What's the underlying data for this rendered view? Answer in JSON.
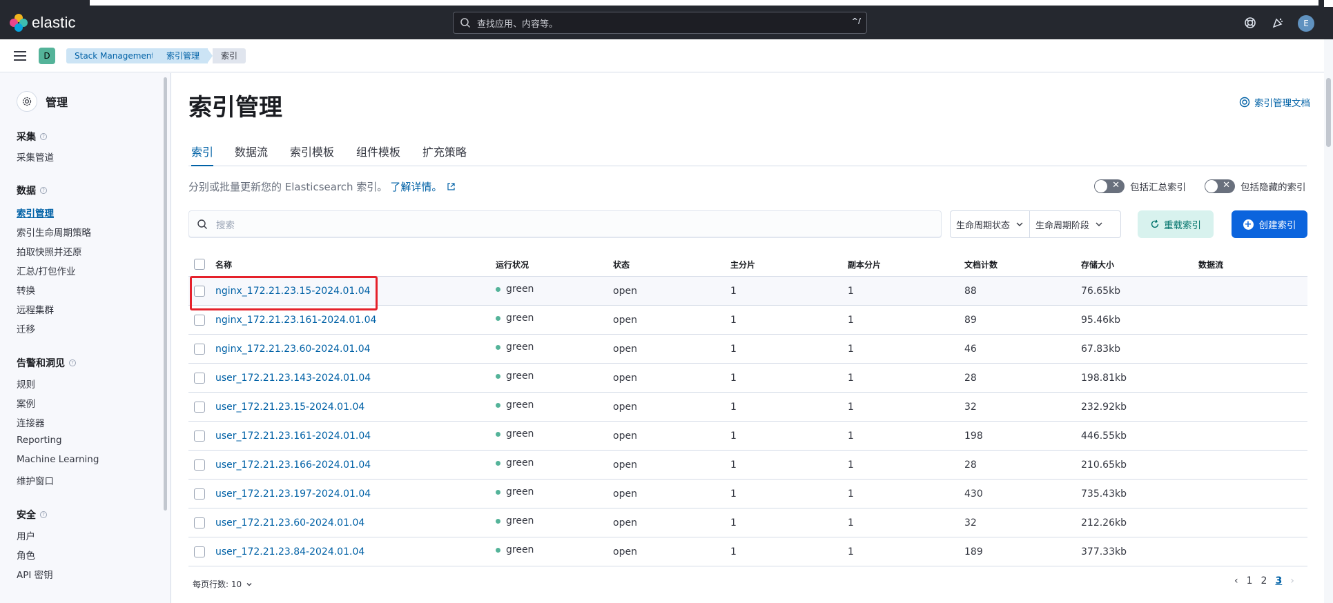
{
  "header": {
    "logo_text": "elastic",
    "search_placeholder": "查找应用、内容等。",
    "search_shortcut": "^/",
    "avatar_initial": "E"
  },
  "breadcrumbs": {
    "space_initial": "D",
    "items": [
      "Stack Management",
      "索引管理",
      "索引"
    ]
  },
  "sidebar": {
    "title": "管理",
    "sections": [
      {
        "title": "采集",
        "items": [
          "采集管道"
        ]
      },
      {
        "title": "数据",
        "items": [
          "索引管理",
          "索引生命周期策略",
          "拍取快照并还原",
          "汇总/打包作业",
          "转换",
          "远程集群",
          "迁移"
        ]
      },
      {
        "title": "告警和洞见",
        "items": [
          "规则",
          "案例",
          "连接器",
          "Reporting",
          "Machine Learning",
          "维护窗口"
        ]
      },
      {
        "title": "安全",
        "items": [
          "用户",
          "角色",
          "API 密钥"
        ]
      }
    ],
    "active_item": "索引管理"
  },
  "main": {
    "title": "索引管理",
    "doc_link": "索引管理文档",
    "tabs": [
      "索引",
      "数据流",
      "索引模板",
      "组件模板",
      "扩充策略"
    ],
    "active_tab": "索引",
    "description": "分别或批量更新您的 Elasticsearch 索引。",
    "learn_more": "了解详情。",
    "toggle_rollup": "包括汇总索引",
    "toggle_hidden": "包括隐藏的索引",
    "search_placeholder": "搜索",
    "filter_lifecycle_status": "生命周期状态",
    "filter_lifecycle_phase": "生命周期阶段",
    "reload_button": "重载索引",
    "create_button": "创建索引"
  },
  "table": {
    "columns": [
      "名称",
      "运行状况",
      "状态",
      "主分片",
      "副本分片",
      "文档计数",
      "存储大小",
      "数据流"
    ],
    "rows": [
      {
        "name": "nginx_172.21.23.15-2024.01.04",
        "health": "green",
        "status": "open",
        "primary": "1",
        "replica": "1",
        "docs": "88",
        "size": "76.65kb"
      },
      {
        "name": "nginx_172.21.23.161-2024.01.04",
        "health": "green",
        "status": "open",
        "primary": "1",
        "replica": "1",
        "docs": "89",
        "size": "95.46kb"
      },
      {
        "name": "nginx_172.21.23.60-2024.01.04",
        "health": "green",
        "status": "open",
        "primary": "1",
        "replica": "1",
        "docs": "46",
        "size": "67.83kb"
      },
      {
        "name": "user_172.21.23.143-2024.01.04",
        "health": "green",
        "status": "open",
        "primary": "1",
        "replica": "1",
        "docs": "28",
        "size": "198.81kb"
      },
      {
        "name": "user_172.21.23.15-2024.01.04",
        "health": "green",
        "status": "open",
        "primary": "1",
        "replica": "1",
        "docs": "32",
        "size": "232.92kb"
      },
      {
        "name": "user_172.21.23.161-2024.01.04",
        "health": "green",
        "status": "open",
        "primary": "1",
        "replica": "1",
        "docs": "198",
        "size": "446.55kb"
      },
      {
        "name": "user_172.21.23.166-2024.01.04",
        "health": "green",
        "status": "open",
        "primary": "1",
        "replica": "1",
        "docs": "28",
        "size": "210.65kb"
      },
      {
        "name": "user_172.21.23.197-2024.01.04",
        "health": "green",
        "status": "open",
        "primary": "1",
        "replica": "1",
        "docs": "430",
        "size": "735.43kb"
      },
      {
        "name": "user_172.21.23.60-2024.01.04",
        "health": "green",
        "status": "open",
        "primary": "1",
        "replica": "1",
        "docs": "32",
        "size": "212.26kb"
      },
      {
        "name": "user_172.21.23.84-2024.01.04",
        "health": "green",
        "status": "open",
        "primary": "1",
        "replica": "1",
        "docs": "189",
        "size": "377.33kb"
      }
    ]
  },
  "pagination": {
    "rows_per_page": "每页行数: 10",
    "pages": [
      "1",
      "2",
      "3"
    ],
    "current_page": "3"
  },
  "colors": {
    "header_bg": "#25282f",
    "link_blue": "#0061a6",
    "health_green": "#54b399",
    "highlight_red": "#e5212b",
    "primary_button": "#0b64dd"
  }
}
